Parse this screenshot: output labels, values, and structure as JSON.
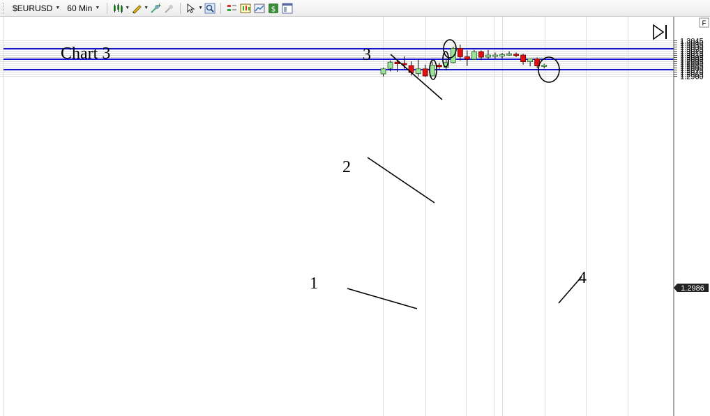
{
  "toolbar": {
    "symbol": "$EURUSD",
    "timeframe": "60 Min"
  },
  "chart_label": "Chart 3",
  "panel_letter": "F",
  "price_badge": "1.2986",
  "annotations": [
    {
      "label": "3",
      "target": {
        "candle": 10,
        "price": 1.3025
      }
    },
    {
      "label": "2",
      "target": {
        "candle": 9,
        "price": 1.3
      }
    },
    {
      "label": "1",
      "target": {
        "candle": 7,
        "price": 1.2975
      }
    },
    {
      "label": "4",
      "target": {
        "candle": 24,
        "price": 1.2975
      }
    }
  ],
  "colors": {
    "bull": "#9be39b",
    "bear": "#e01010",
    "line": "#1414d2",
    "badge": "#222222",
    "grid": "#dcdcdc"
  },
  "chart_data": {
    "type": "candlestick",
    "ylim": [
      1.2955,
      1.3052
    ],
    "y_ticks": [
      "1.3045",
      "1.3040",
      "1.3035",
      "1.3030",
      "1.3025",
      "1.3020",
      "1.3015",
      "1.3010",
      "1.3005",
      "1.3000",
      "1.2995",
      "1.2990",
      "1.2985",
      "1.2980",
      "1.2975",
      "1.2970",
      "1.2965",
      "1.2960"
    ],
    "horizontal_lines": [
      1.3025,
      1.3,
      1.2975
    ],
    "candles": [
      {
        "o": 1.2965,
        "h": 1.298,
        "l": 1.2959,
        "c": 1.2977
      },
      {
        "o": 1.2978,
        "h": 1.2997,
        "l": 1.2971,
        "c": 1.2993
      },
      {
        "o": 1.2993,
        "h": 1.2997,
        "l": 1.297,
        "c": 1.2989
      },
      {
        "o": 1.299,
        "h": 1.3007,
        "l": 1.2977,
        "c": 1.2987
      },
      {
        "o": 1.2985,
        "h": 1.2995,
        "l": 1.2961,
        "c": 1.2968
      },
      {
        "o": 1.2966,
        "h": 1.2999,
        "l": 1.2959,
        "c": 1.2977
      },
      {
        "o": 1.2977,
        "h": 1.2987,
        "l": 1.2958,
        "c": 1.296
      },
      {
        "o": 1.296,
        "h": 1.2994,
        "l": 1.296,
        "c": 1.2986
      },
      {
        "o": 1.2986,
        "h": 1.2992,
        "l": 1.2976,
        "c": 1.2982
      },
      {
        "o": 1.2981,
        "h": 1.3002,
        "l": 1.2973,
        "c": 1.2992
      },
      {
        "o": 1.2992,
        "h": 1.303,
        "l": 1.299,
        "c": 1.3026
      },
      {
        "o": 1.3026,
        "h": 1.3035,
        "l": 1.2997,
        "c": 1.3006
      },
      {
        "o": 1.3006,
        "h": 1.3021,
        "l": 1.2984,
        "c": 1.3
      },
      {
        "o": 1.3,
        "h": 1.3022,
        "l": 1.2999,
        "c": 1.3018
      },
      {
        "o": 1.3018,
        "h": 1.3021,
        "l": 1.2998,
        "c": 1.3005
      },
      {
        "o": 1.3005,
        "h": 1.3022,
        "l": 1.3,
        "c": 1.301
      },
      {
        "o": 1.301,
        "h": 1.3016,
        "l": 1.3,
        "c": 1.301
      },
      {
        "o": 1.3009,
        "h": 1.3015,
        "l": 1.3002,
        "c": 1.3011
      },
      {
        "o": 1.3011,
        "h": 1.3019,
        "l": 1.3008,
        "c": 1.3013
      },
      {
        "o": 1.3012,
        "h": 1.3016,
        "l": 1.3005,
        "c": 1.301
      },
      {
        "o": 1.301,
        "h": 1.3013,
        "l": 1.2987,
        "c": 1.2994
      },
      {
        "o": 1.2994,
        "h": 1.3002,
        "l": 1.2983,
        "c": 1.3001
      },
      {
        "o": 1.3001,
        "h": 1.3004,
        "l": 1.2979,
        "c": 1.2984
      },
      {
        "o": 1.2984,
        "h": 1.2989,
        "l": 1.2978,
        "c": 1.2986
      }
    ]
  }
}
